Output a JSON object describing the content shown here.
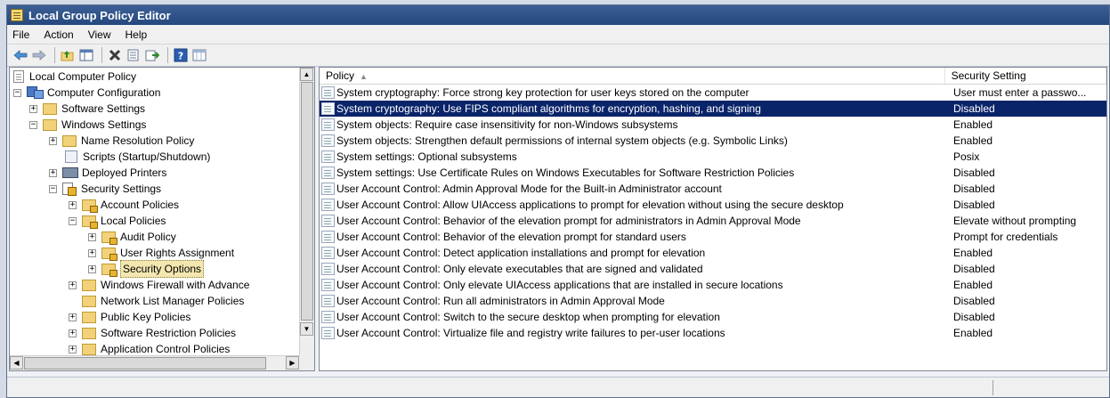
{
  "window": {
    "title": "Local Group Policy Editor"
  },
  "menu": [
    "File",
    "Action",
    "View",
    "Help"
  ],
  "toolbar": {
    "buttons": [
      "back-icon",
      "forward-icon",
      "up-folder-icon",
      "show-hide-tree-icon",
      "delete-icon",
      "properties-icon",
      "export-list-icon",
      "help-icon",
      "view-icon"
    ]
  },
  "tree": {
    "items": [
      {
        "label": "Local Computer Policy",
        "icon": "document-icon"
      },
      {
        "label": "Computer Configuration",
        "icon": "computer-icon",
        "expander": "−"
      },
      {
        "label": "Software Settings",
        "icon": "folder-icon",
        "expander": "+"
      },
      {
        "label": "Windows Settings",
        "icon": "folder-icon",
        "expander": "−"
      },
      {
        "label": "Name Resolution Policy",
        "icon": "folder-icon",
        "expander": "+"
      },
      {
        "label": "Scripts (Startup/Shutdown)",
        "icon": "script-icon"
      },
      {
        "label": "Deployed Printers",
        "icon": "printer-icon",
        "expander": "+"
      },
      {
        "label": "Security Settings",
        "icon": "security-settings-icon",
        "expander": "−"
      },
      {
        "label": "Account Policies",
        "icon": "locked-folder-icon",
        "expander": "+"
      },
      {
        "label": "Local Policies",
        "icon": "locked-folder-icon",
        "expander": "−"
      },
      {
        "label": "Audit Policy",
        "icon": "locked-folder-icon",
        "expander": "+"
      },
      {
        "label": "User Rights Assignment",
        "icon": "locked-folder-icon",
        "expander": "+"
      },
      {
        "label": "Security Options",
        "icon": "locked-folder-icon",
        "expander": "+",
        "selected": true
      },
      {
        "label": "Windows Firewall with Advance",
        "icon": "folder-icon",
        "expander": "+"
      },
      {
        "label": "Network List Manager Policies",
        "icon": "folder-icon"
      },
      {
        "label": "Public Key Policies",
        "icon": "folder-icon",
        "expander": "+"
      },
      {
        "label": "Software Restriction Policies",
        "icon": "folder-icon",
        "expander": "+"
      },
      {
        "label": "Application Control Policies",
        "icon": "folder-icon",
        "expander": "+"
      }
    ]
  },
  "list": {
    "columns": {
      "policy": "Policy",
      "setting": "Security Setting"
    },
    "rows": [
      {
        "policy": "System cryptography: Force strong key protection for user keys stored on the computer",
        "setting": "User must enter a passwo..."
      },
      {
        "policy": "System cryptography: Use FIPS compliant algorithms for encryption, hashing, and signing",
        "setting": "Disabled",
        "selected": true
      },
      {
        "policy": "System objects: Require case insensitivity for non-Windows subsystems",
        "setting": "Enabled"
      },
      {
        "policy": "System objects: Strengthen default permissions of internal system objects (e.g. Symbolic Links)",
        "setting": "Enabled"
      },
      {
        "policy": "System settings: Optional subsystems",
        "setting": "Posix"
      },
      {
        "policy": "System settings: Use Certificate Rules on Windows Executables for Software Restriction Policies",
        "setting": "Disabled"
      },
      {
        "policy": "User Account Control: Admin Approval Mode for the Built-in Administrator account",
        "setting": "Disabled"
      },
      {
        "policy": "User Account Control: Allow UIAccess applications to prompt for elevation without using the secure desktop",
        "setting": "Disabled"
      },
      {
        "policy": "User Account Control: Behavior of the elevation prompt for administrators in Admin Approval Mode",
        "setting": "Elevate without prompting"
      },
      {
        "policy": "User Account Control: Behavior of the elevation prompt for standard users",
        "setting": "Prompt for credentials"
      },
      {
        "policy": "User Account Control: Detect application installations and prompt for elevation",
        "setting": "Enabled"
      },
      {
        "policy": "User Account Control: Only elevate executables that are signed and validated",
        "setting": "Disabled"
      },
      {
        "policy": "User Account Control: Only elevate UIAccess applications that are installed in secure locations",
        "setting": "Enabled"
      },
      {
        "policy": "User Account Control: Run all administrators in Admin Approval Mode",
        "setting": "Disabled"
      },
      {
        "policy": "User Account Control: Switch to the secure desktop when prompting for elevation",
        "setting": "Disabled"
      },
      {
        "policy": "User Account Control: Virtualize file and registry write failures to per-user locations",
        "setting": "Enabled"
      }
    ]
  },
  "colors": {
    "selection": "#0a246a",
    "title_bar": "#2a4d84",
    "tree_selection": "#f3e6b0"
  }
}
